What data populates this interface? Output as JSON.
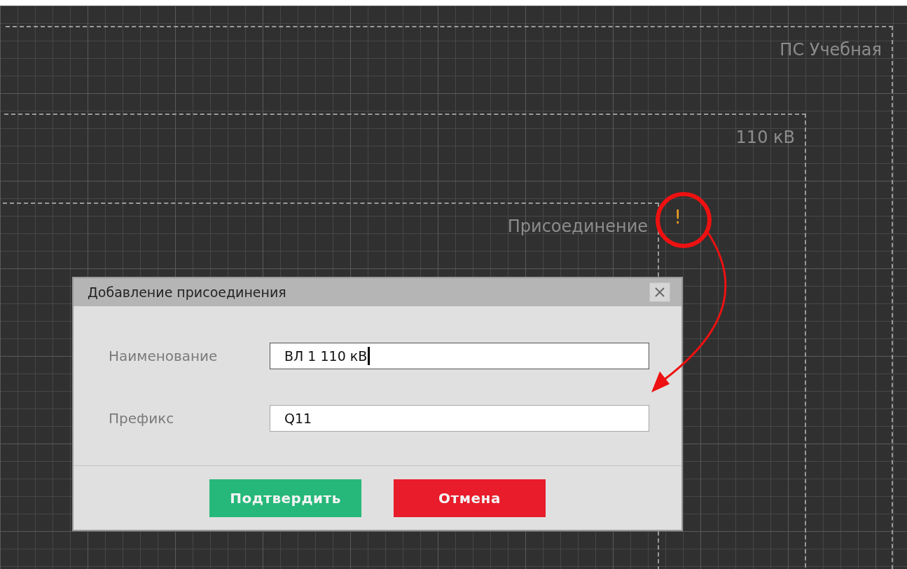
{
  "canvas": {
    "regions": [
      {
        "label": "ПС Учебная",
        "children": [
          {
            "label": "110 кВ",
            "children": [
              {
                "label": "Присоединение",
                "warning": "!"
              }
            ]
          }
        ]
      }
    ]
  },
  "dialog": {
    "title": "Добавление присоединения",
    "fields": [
      {
        "label": "Наименование",
        "value": "ВЛ 1 110 кВ",
        "focused": true
      },
      {
        "label": "Префикс",
        "value": "Q11",
        "focused": false
      }
    ],
    "buttons": [
      {
        "label": "Подтвердить",
        "kind": "confirm"
      },
      {
        "label": "Отмена",
        "kind": "cancel"
      }
    ]
  }
}
